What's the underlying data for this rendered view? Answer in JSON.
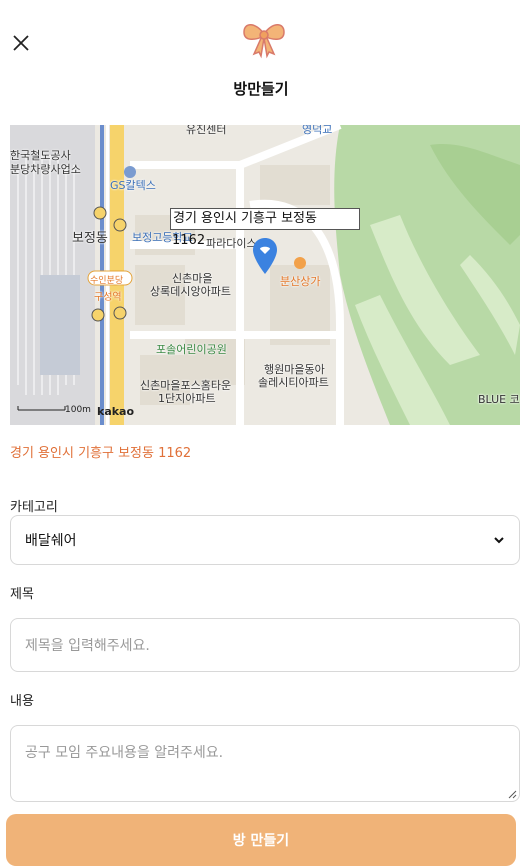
{
  "header": {
    "title": "방만들기",
    "close_icon": "close-icon",
    "logo_icon": "ribbon-bow-icon"
  },
  "map": {
    "popup_line1": "경기 용인시 기흥구 보정동",
    "popup_line2": "1162",
    "labels": {
      "railway_1": "한국철도공사",
      "railway_2": "분당차량사업소",
      "bojeong": "보정동",
      "gs": "GS칼텍스",
      "school": "보정고등학교",
      "paradise": "파라다이스",
      "village1_1": "신촌마을",
      "village1_2": "상록데시앙아파트",
      "bunsan": "분산상가",
      "park": "포솔어린이공원",
      "haengwon_1": "행원마을동아",
      "haengwon_2": "솔레시티아파트",
      "posco_1": "신촌마을포스홈타운",
      "posco_2": "1단지아파트",
      "suin_1": "수인분당",
      "suin_2": "구성역",
      "blue": "BLUE 코스",
      "top_center": "유진센터",
      "top_right": "영덕교"
    },
    "scale_label": "100m",
    "provider": "kakao"
  },
  "address": "경기 용인시 기흥구 보정동 1162",
  "form": {
    "category_label": "카테고리",
    "category_value": "배달쉐어",
    "title_label": "제목",
    "title_placeholder": "제목을 입력해주세요.",
    "content_label": "내용",
    "content_placeholder": "공구 모임 주요내용을 알려주세요."
  },
  "submit_label": "방 만들기",
  "colors": {
    "accent": "#f0b378",
    "address": "#e07038",
    "pin": "#3b82e0"
  }
}
